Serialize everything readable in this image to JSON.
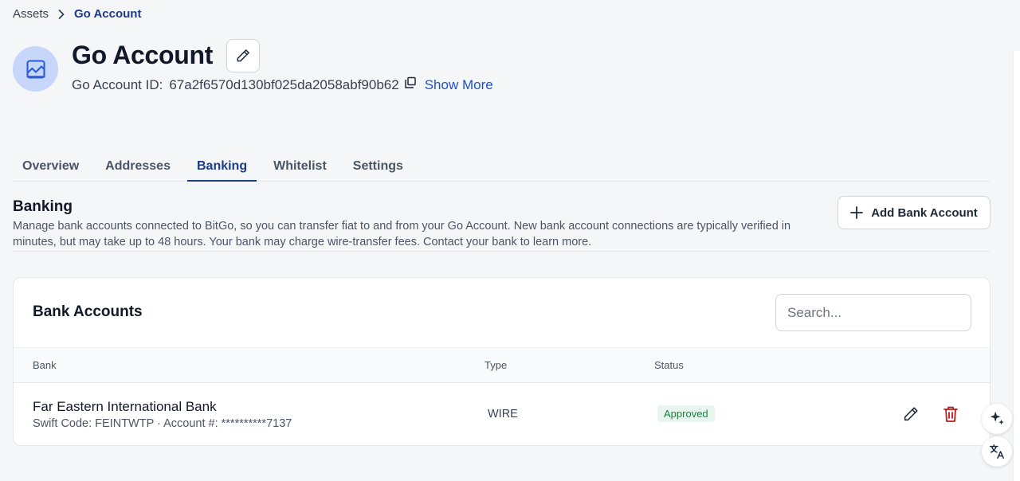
{
  "breadcrumb": {
    "root": "Assets",
    "current": "Go Account"
  },
  "header": {
    "title": "Go Account",
    "account_id_label": "Go Account ID:",
    "account_id_value": "67a2f6570d130bf025da2058abf90b62",
    "show_more": "Show More"
  },
  "tabs": [
    "Overview",
    "Addresses",
    "Banking",
    "Whitelist",
    "Settings"
  ],
  "active_tab": "Banking",
  "banking": {
    "title": "Banking",
    "description": "Manage bank accounts connected to BitGo, so you can transfer fiat to and from your Go Account. New bank account connections are typically verified in minutes, but may take up to 48 hours. Your bank may charge wire-transfer fees. Contact your bank to learn more.",
    "add_button": "Add Bank Account"
  },
  "bank_accounts": {
    "title": "Bank Accounts",
    "search_placeholder": "Search...",
    "columns": {
      "bank": "Bank",
      "type": "Type",
      "status": "Status"
    },
    "rows": [
      {
        "bank_name": "Far Eastern International Bank",
        "meta": "Swift Code: FEINTWTP · Account #: **********7137",
        "type": "WIRE",
        "status": "Approved"
      }
    ]
  },
  "colors": {
    "accent": "#1e3a8a",
    "link": "#1d4ed8",
    "approved": "#15803d",
    "delete": "#b91c1c",
    "avatar_bg": "#c7d7fb"
  },
  "icons": {
    "avatar": "chart-line-icon",
    "edit": "pencil-icon",
    "copy": "copy-icon",
    "add": "plus-icon",
    "delete": "trash-icon",
    "ai": "sparkle-icon",
    "translate": "translate-icon"
  }
}
